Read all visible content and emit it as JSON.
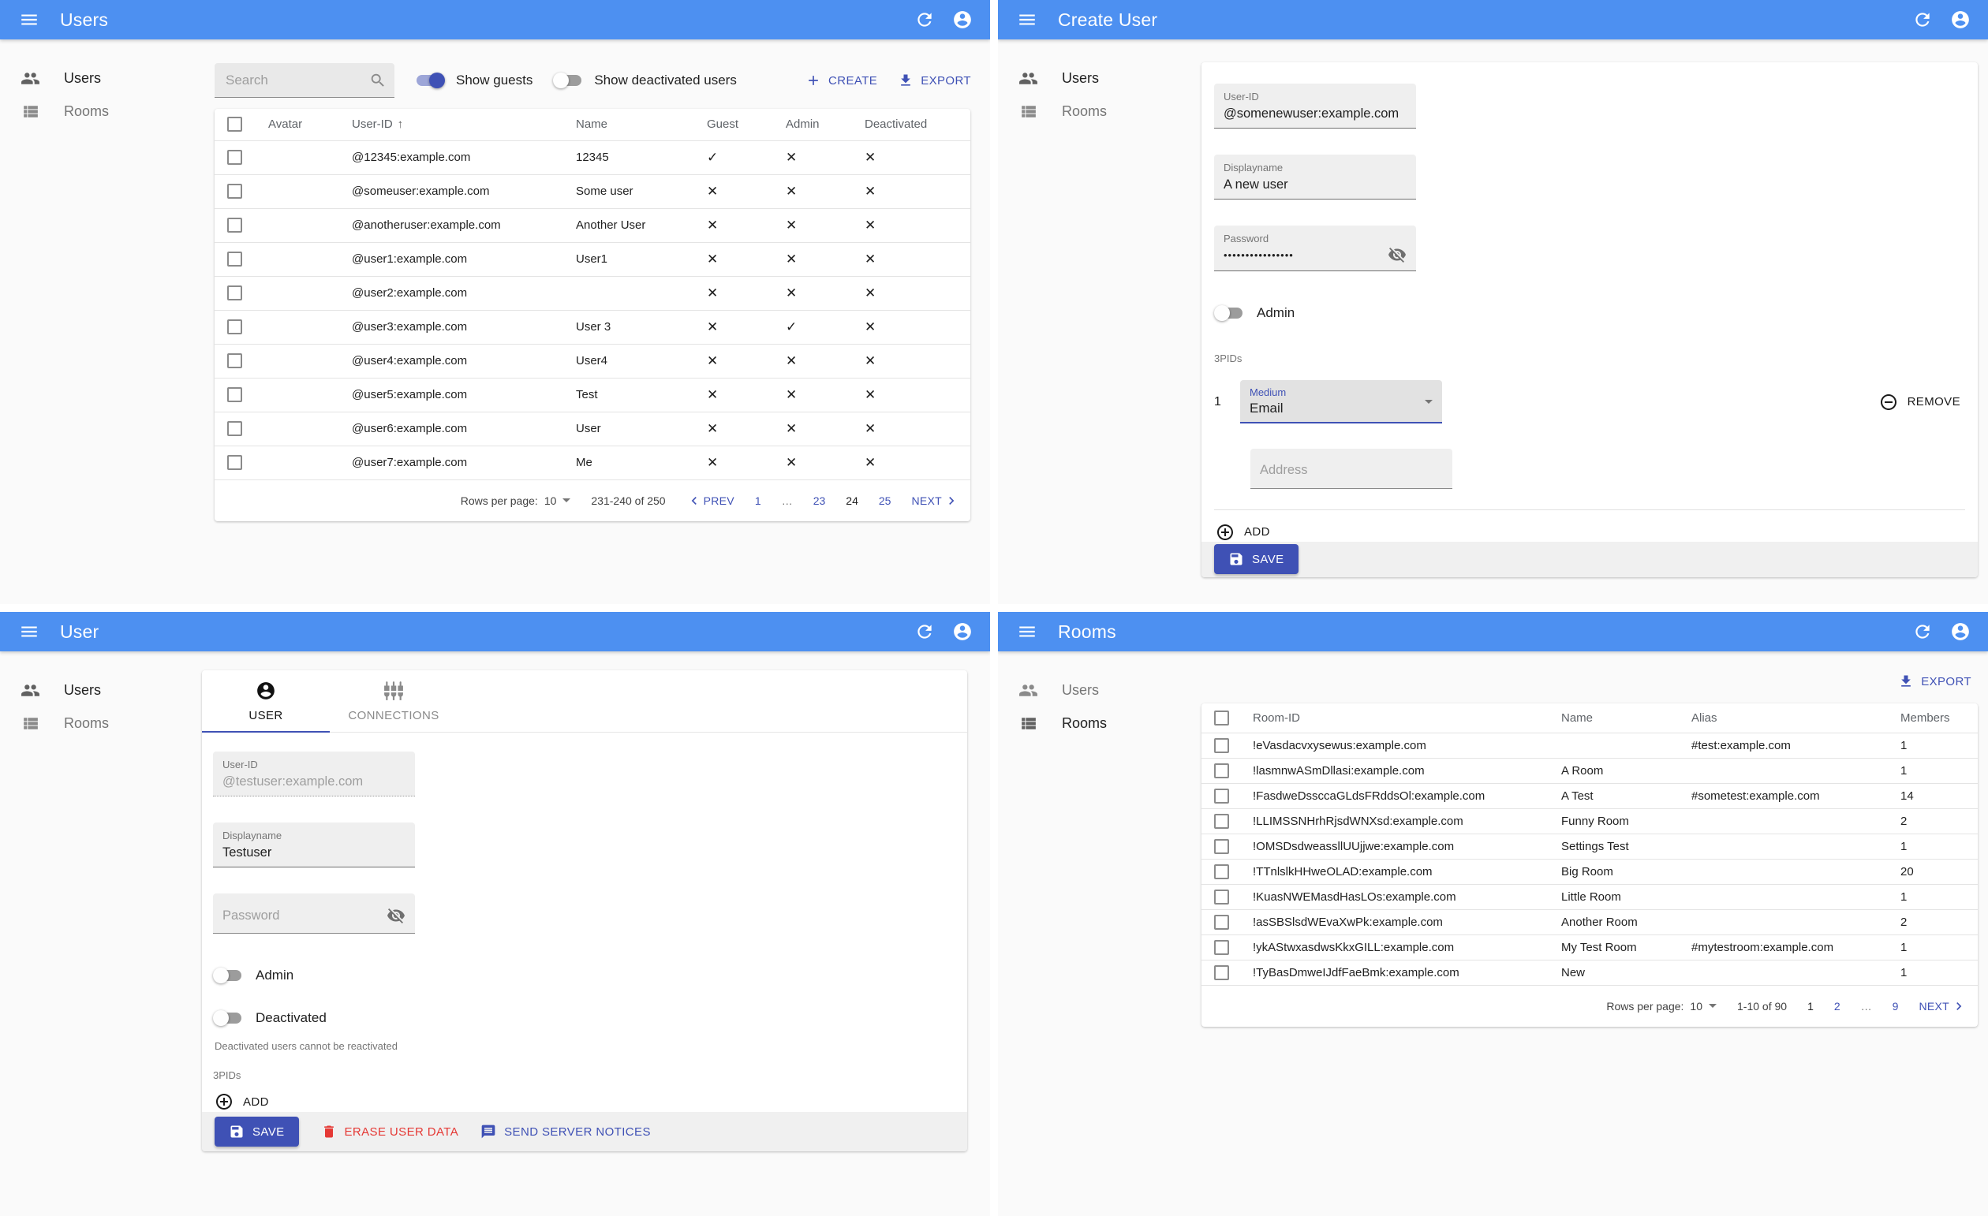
{
  "colors": {
    "appbar": "#4d90f1",
    "primary": "#3f51b5",
    "danger": "#e53935"
  },
  "panel_users": {
    "title": "Users",
    "nav_users": "Users",
    "nav_rooms": "Rooms",
    "search_placeholder": "Search",
    "show_guests_label": "Show guests",
    "show_deactivated_label": "Show deactivated users",
    "create_label": "CREATE",
    "export_label": "EXPORT",
    "columns": {
      "avatar": "Avatar",
      "user_id": "User-ID",
      "sort_arrow": "↑",
      "name": "Name",
      "guest": "Guest",
      "admin": "Admin",
      "deactivated": "Deactivated"
    },
    "rows": [
      {
        "id": "@12345:example.com",
        "name": "12345",
        "guest": "✓",
        "admin": "✕",
        "deactivated": "✕"
      },
      {
        "id": "@someuser:example.com",
        "name": "Some user",
        "guest": "✕",
        "admin": "✕",
        "deactivated": "✕"
      },
      {
        "id": "@anotheruser:example.com",
        "name": "Another User",
        "guest": "✕",
        "admin": "✕",
        "deactivated": "✕"
      },
      {
        "id": "@user1:example.com",
        "name": "User1",
        "guest": "✕",
        "admin": "✕",
        "deactivated": "✕"
      },
      {
        "id": "@user2:example.com",
        "name": "",
        "guest": "✕",
        "admin": "✕",
        "deactivated": "✕"
      },
      {
        "id": "@user3:example.com",
        "name": "User 3",
        "guest": "✕",
        "admin": "✓",
        "deactivated": "✕"
      },
      {
        "id": "@user4:example.com",
        "name": "User4",
        "guest": "✕",
        "admin": "✕",
        "deactivated": "✕"
      },
      {
        "id": "@user5:example.com",
        "name": "Test",
        "guest": "✕",
        "admin": "✕",
        "deactivated": "✕"
      },
      {
        "id": "@user6:example.com",
        "name": "User",
        "guest": "✕",
        "admin": "✕",
        "deactivated": "✕"
      },
      {
        "id": "@user7:example.com",
        "name": "Me",
        "guest": "✕",
        "admin": "✕",
        "deactivated": "✕"
      }
    ],
    "pager": {
      "rows_per_page_label": "Rows per page:",
      "per_page": "10",
      "range": "231-240 of 250",
      "prev_label": "PREV",
      "next_label": "NEXT",
      "pages": [
        {
          "t": "1",
          "state": "link"
        },
        {
          "t": "…",
          "state": "gap"
        },
        {
          "t": "23",
          "state": "link"
        },
        {
          "t": "24",
          "state": "current"
        },
        {
          "t": "25",
          "state": "link"
        }
      ]
    }
  },
  "panel_create": {
    "title": "Create User",
    "nav_users": "Users",
    "nav_rooms": "Rooms",
    "user_id_label": "User-ID",
    "user_id_value": "@somenewuser:example.com",
    "displayname_label": "Displayname",
    "displayname_value": "A new user",
    "password_label": "Password",
    "password_value": "••••••••••••••••",
    "admin_label": "Admin",
    "threepids_label": "3PIDs",
    "row_index": "1",
    "medium_label": "Medium",
    "medium_value": "Email",
    "remove_label": "REMOVE",
    "address_placeholder": "Address",
    "add_label": "ADD",
    "save_label": "SAVE"
  },
  "panel_user": {
    "title": "User",
    "nav_users": "Users",
    "nav_rooms": "Rooms",
    "tab_user": "USER",
    "tab_connections": "CONNECTIONS",
    "user_id_label": "User-ID",
    "user_id_value": "@testuser:example.com",
    "displayname_label": "Displayname",
    "displayname_value": "Testuser",
    "password_placeholder": "Password",
    "admin_label": "Admin",
    "deactivated_label": "Deactivated",
    "deactivated_helper": "Deactivated users cannot be reactivated",
    "threepids_label": "3PIDs",
    "add_label": "ADD",
    "save_label": "SAVE",
    "erase_label": "ERASE USER DATA",
    "notices_label": "SEND SERVER NOTICES"
  },
  "panel_rooms": {
    "title": "Rooms",
    "nav_users": "Users",
    "nav_rooms": "Rooms",
    "export_label": "EXPORT",
    "columns": {
      "room_id": "Room-ID",
      "name": "Name",
      "alias": "Alias",
      "members": "Members"
    },
    "rows": [
      {
        "id": "!eVasdacvxysewus:example.com",
        "name": "",
        "alias": "#test:example.com",
        "members": "1"
      },
      {
        "id": "!lasmnwASmDllasi:example.com",
        "name": "A Room",
        "alias": "",
        "members": "1"
      },
      {
        "id": "!FasdweDssccaGLdsFRddsOl:example.com",
        "name": "A Test",
        "alias": "#sometest:example.com",
        "members": "14"
      },
      {
        "id": "!LLIMSSNHrhRjsdWNXsd:example.com",
        "name": "Funny Room",
        "alias": "",
        "members": "2"
      },
      {
        "id": "!OMSDsdweassllUUjjwe:example.com",
        "name": "Settings Test",
        "alias": "",
        "members": "1"
      },
      {
        "id": "!TTnlslkHHweOLAD:example.com",
        "name": "Big Room",
        "alias": "",
        "members": "20"
      },
      {
        "id": "!KuasNWEMasdHasLOs:example.com",
        "name": "Little Room",
        "alias": "",
        "members": "1"
      },
      {
        "id": "!asSBSlsdWEvaXwPk:example.com",
        "name": "Another Room",
        "alias": "",
        "members": "2"
      },
      {
        "id": "!ykAStwxasdwsKkxGILL:example.com",
        "name": "My Test Room",
        "alias": "#mytestroom:example.com",
        "members": "1"
      },
      {
        "id": "!TyBasDmweIJdfFaeBmk:example.com",
        "name": "New",
        "alias": "",
        "members": "1"
      }
    ],
    "pager": {
      "rows_per_page_label": "Rows per page:",
      "per_page": "10",
      "range": "1-10 of 90",
      "next_label": "NEXT",
      "pages": [
        {
          "t": "1",
          "state": "current"
        },
        {
          "t": "2",
          "state": "link"
        },
        {
          "t": "…",
          "state": "gap"
        },
        {
          "t": "9",
          "state": "link"
        }
      ]
    }
  }
}
